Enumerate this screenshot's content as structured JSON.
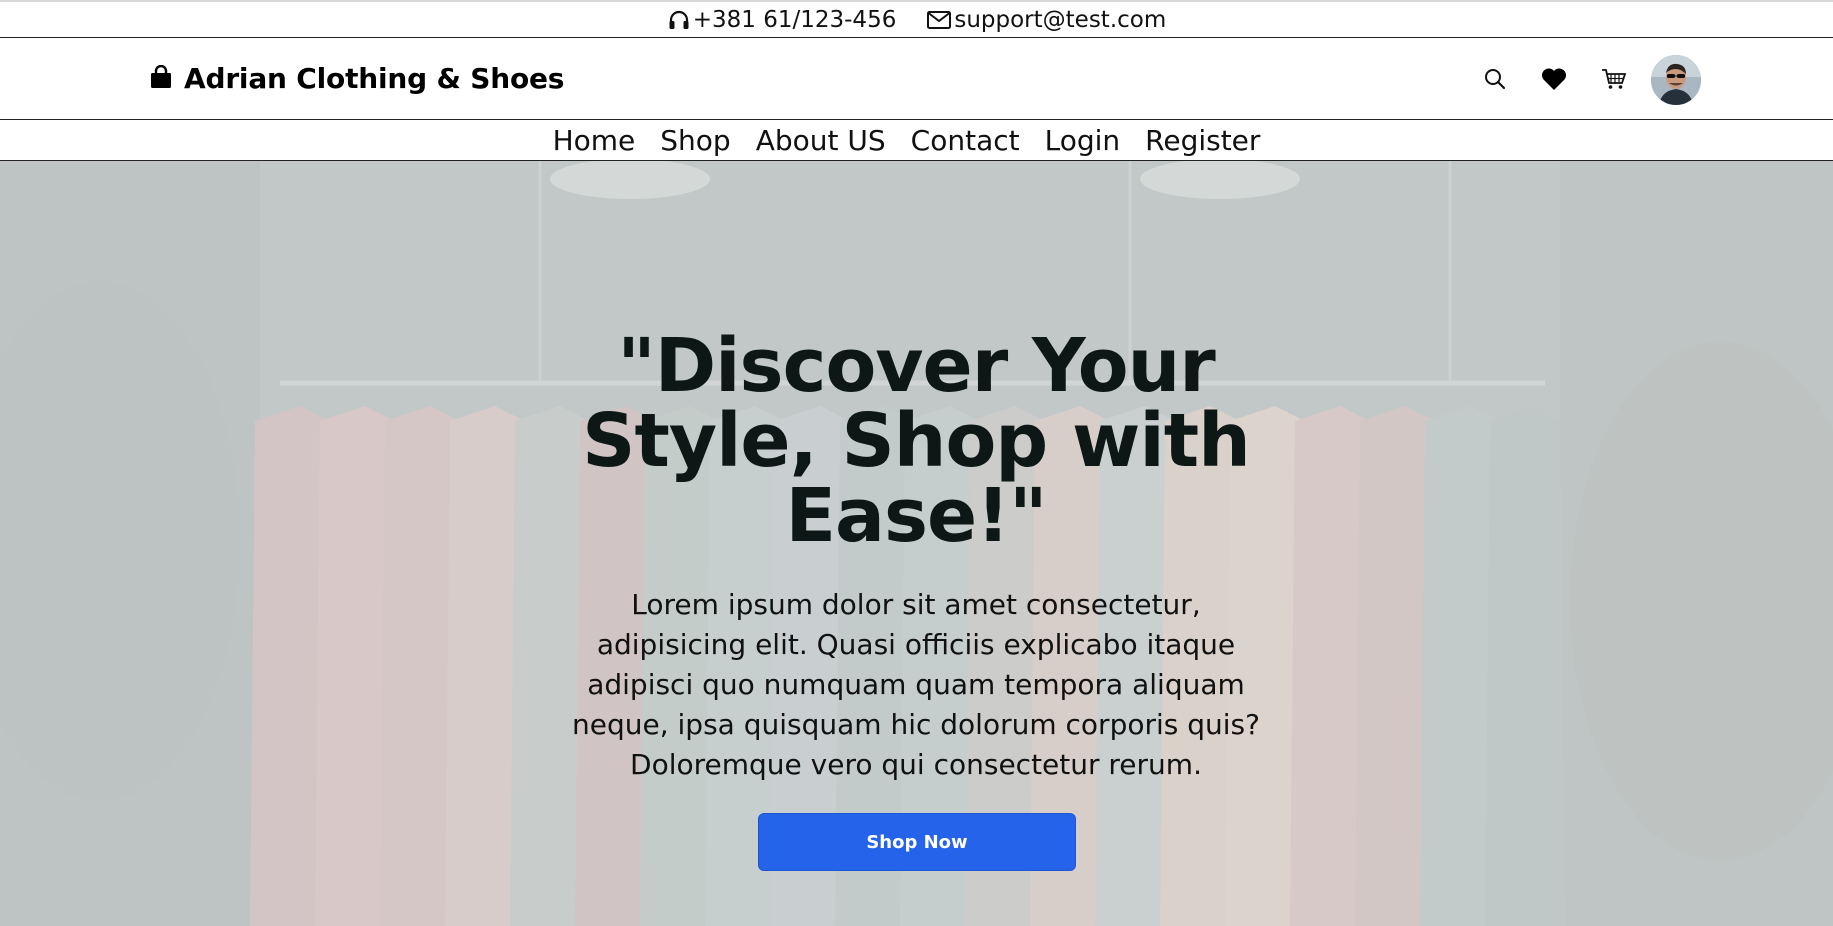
{
  "topbar": {
    "phone": "+381 61/123-456",
    "email": "support@test.com",
    "phone_icon": "headphones-icon",
    "email_icon": "envelope-icon"
  },
  "header": {
    "brand": "Adrian Clothing & Shoes",
    "brand_icon": "shopping-bag-icon",
    "icons": [
      "search-icon",
      "heart-icon",
      "cart-icon",
      "user-avatar"
    ]
  },
  "nav": {
    "items": [
      "Home",
      "Shop",
      "About US",
      "Contact",
      "Login",
      "Register"
    ]
  },
  "hero": {
    "title": "\"Discover Your Style, Shop with Ease!\"",
    "text": "Lorem ipsum dolor sit amet consectetur, adipisicing elit. Quasi officiis explicabo itaque adipisci quo numquam quam tempora aliquam neque, ipsa quisquam hic dolorum corporis quis? Doloremque vero qui consectetur rerum.",
    "button": "Shop Now"
  },
  "colors": {
    "accent": "#2563eb",
    "title": "#0d1816"
  }
}
